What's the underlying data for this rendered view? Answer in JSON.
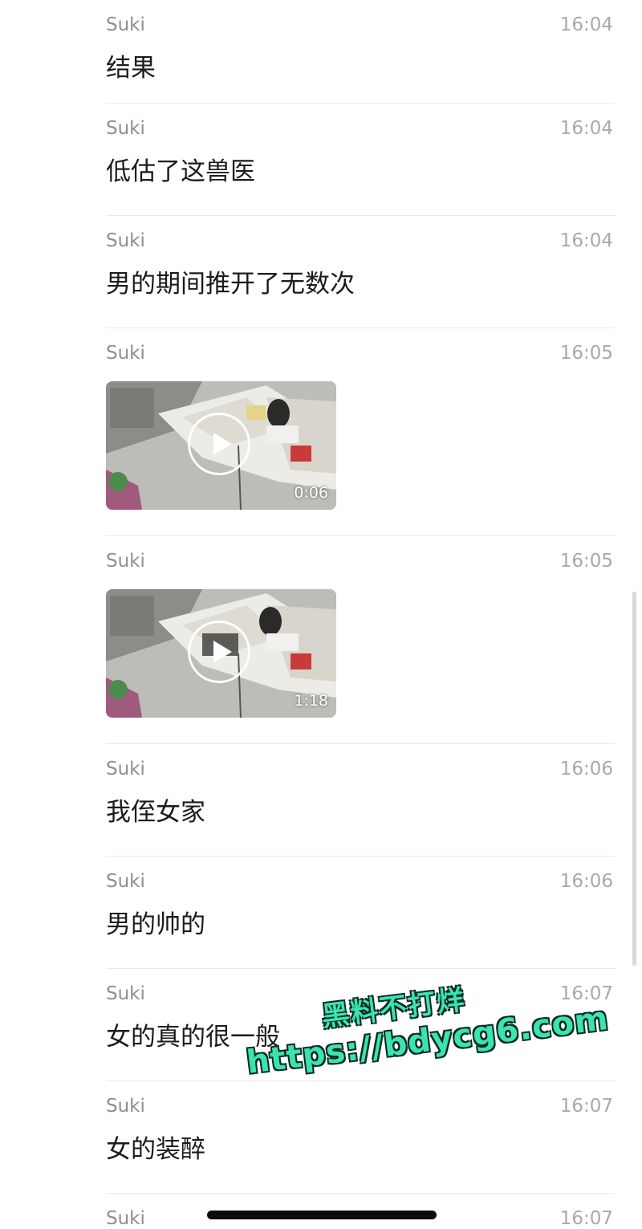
{
  "messages": [
    {
      "sender": "Suki",
      "time": "16:04",
      "type": "text",
      "text": "结果"
    },
    {
      "sender": "Suki",
      "time": "16:04",
      "type": "text",
      "text": "低估了这兽医"
    },
    {
      "sender": "Suki",
      "time": "16:04",
      "type": "text",
      "text": "男的期间推开了无数次"
    },
    {
      "sender": "Suki",
      "time": "16:05",
      "type": "video",
      "duration": "0:06"
    },
    {
      "sender": "Suki",
      "time": "16:05",
      "type": "video",
      "duration": "1:18"
    },
    {
      "sender": "Suki",
      "time": "16:06",
      "type": "text",
      "text": "我侄女家"
    },
    {
      "sender": "Suki",
      "time": "16:06",
      "type": "text",
      "text": "男的帅的"
    },
    {
      "sender": "Suki",
      "time": "16:07",
      "type": "text",
      "text": "女的真的很一般"
    },
    {
      "sender": "Suki",
      "time": "16:07",
      "type": "text",
      "text": "女的装醉"
    },
    {
      "sender": "Suki",
      "time": "16:07",
      "type": "text",
      "text": ""
    }
  ],
  "watermark": {
    "line1": "黑料不打烊",
    "line2": "https://bdycg6.com"
  },
  "icons": {
    "play": "play-icon"
  },
  "colors": {
    "watermark": "#3be3b0",
    "divider": "#e9e9e9"
  }
}
